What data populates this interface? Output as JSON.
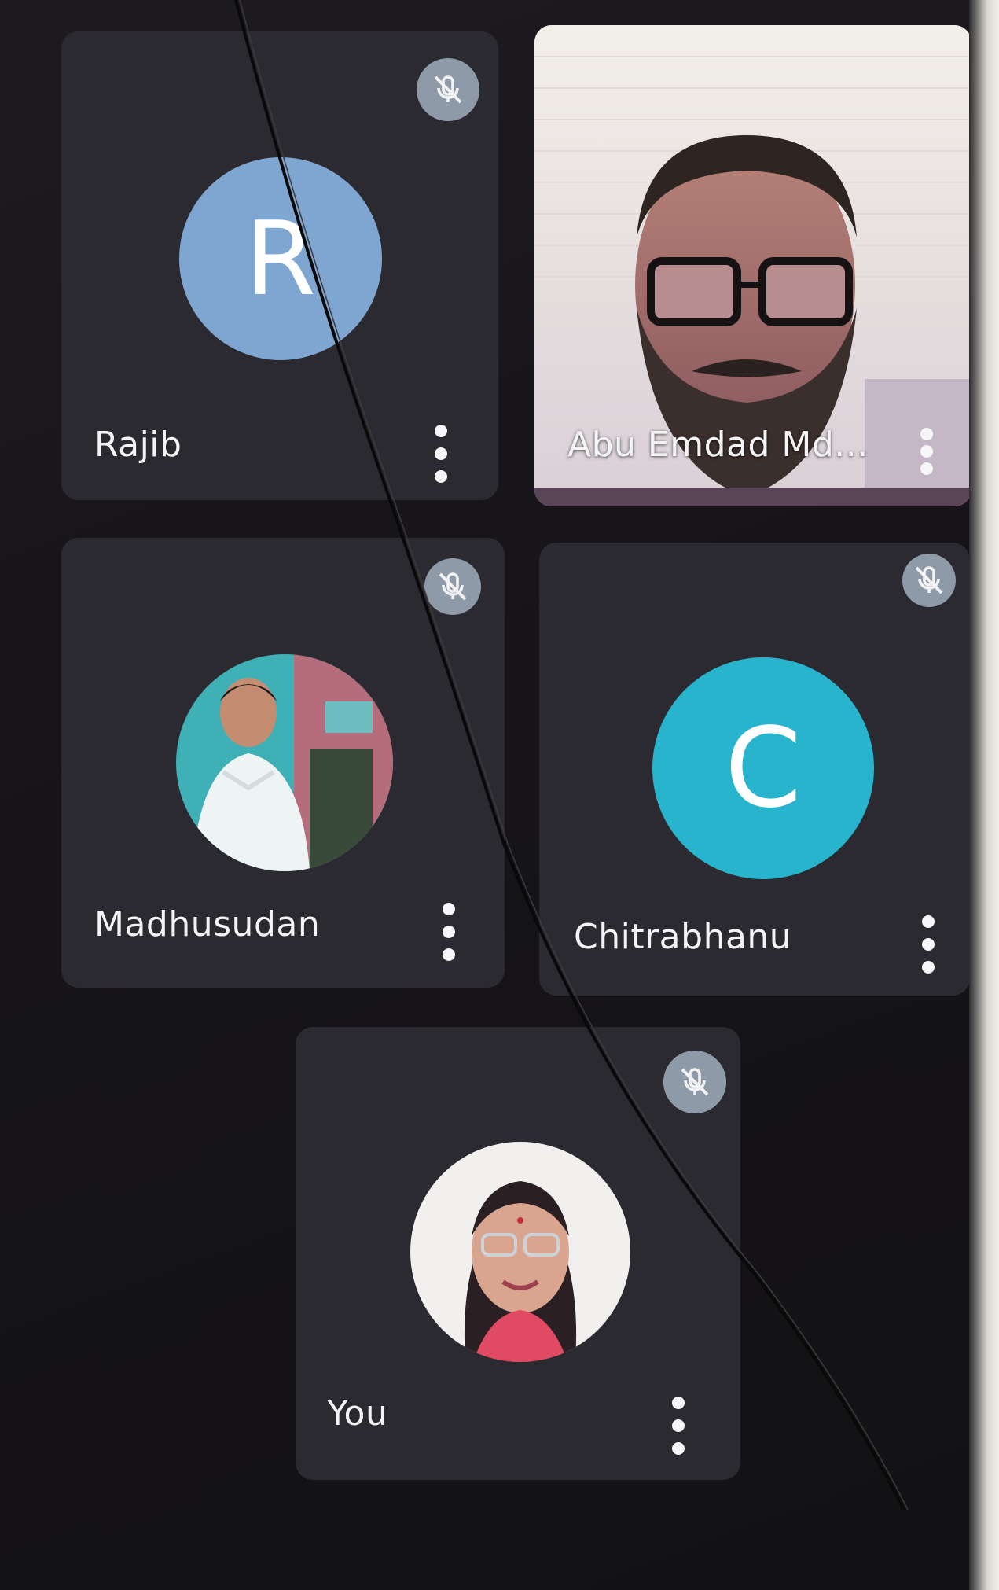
{
  "participants": [
    {
      "name": "Rajib",
      "avatar_letter": "R",
      "avatar_color": "#7ea6d1",
      "muted": true,
      "icon": "mic-off-icon"
    },
    {
      "name": "Abu Emdad Md...",
      "video_on": true,
      "muted": false
    },
    {
      "name": "Madhusudan",
      "avatar": "profile-photo",
      "muted": true,
      "icon": "mic-off-icon"
    },
    {
      "name": "Chitrabhanu",
      "avatar_letter": "C",
      "avatar_color": "#28b4cc",
      "muted": true,
      "icon": "mic-off-icon"
    },
    {
      "name": "You",
      "avatar": "profile-photo",
      "muted": true,
      "icon": "mic-off-icon"
    }
  ],
  "more_options_icon": "more-vert-icon",
  "colors": {
    "background": "#161418",
    "tile": "#2b2a30",
    "mic_badge": "#8f9aa8"
  }
}
